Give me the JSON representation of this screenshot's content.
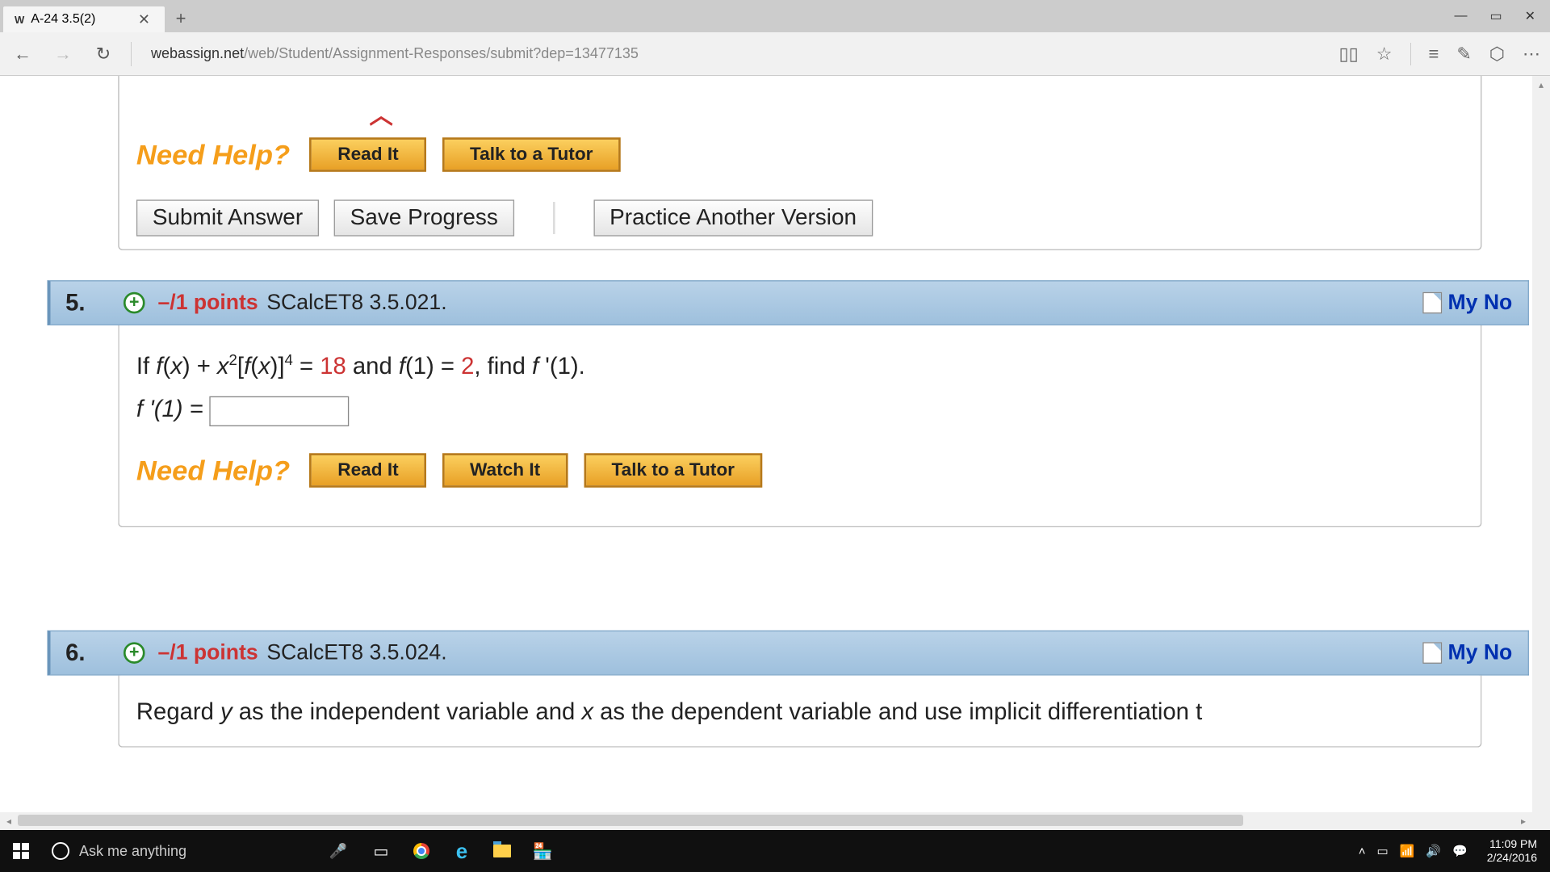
{
  "window": {
    "tab_title": "A-24 3.5(2)",
    "minimize": "—",
    "maximize": "▭",
    "close": "✕",
    "new_tab": "+",
    "tab_close": "✕"
  },
  "toolbar": {
    "back": "←",
    "forward": "→",
    "refresh": "↻",
    "url_domain": "webassign.net",
    "url_path": "/web/Student/Assignment-Responses/submit?dep=13477135",
    "reading": "▯▯",
    "star": "☆",
    "hub": "≡",
    "note": "✎",
    "share": "⬡",
    "more": "⋯"
  },
  "q4": {
    "need_help": "Need Help?",
    "read_it": "Read It",
    "talk_tutor": "Talk to a Tutor",
    "submit": "Submit Answer",
    "save": "Save Progress",
    "practice": "Practice Another Version",
    "chevron": "︿"
  },
  "q5": {
    "number": "5.",
    "expand": "+",
    "points": "–/1 points",
    "reference": "SCalcET8 3.5.021.",
    "my_notes": "My No",
    "problem_prefix": "If  ",
    "eq_lhs1": "f",
    "eq_lhs2": "(",
    "eq_lhs3": "x",
    "eq_lhs4": ") + ",
    "eq_lhs5": "x",
    "sup2": "2",
    "eq_lhs6": "[",
    "eq_lhs7": "f",
    "eq_lhs8": "(",
    "eq_lhs9": "x",
    "eq_lhs10": ")]",
    "sup4": "4",
    "eq_mid": " = ",
    "eighteen": "18",
    "eq_and": " and ",
    "eq_f1": "f",
    "eq_f1p": "(1) = ",
    "two": "2",
    "eq_find": ",  find ",
    "eq_target": "f ",
    "prime": "'",
    "eq_target2": "(1).",
    "answer_label": "f '(1) = ",
    "need_help": "Need Help?",
    "read_it": "Read It",
    "watch_it": "Watch It",
    "talk_tutor": "Talk to a Tutor"
  },
  "q6": {
    "number": "6.",
    "expand": "+",
    "points": "–/1 points",
    "reference": "SCalcET8 3.5.024.",
    "my_notes": "My No",
    "text_prefix": "Regard ",
    "y": "y",
    "text_mid1": " as the independent variable and ",
    "x": "x",
    "text_mid2": " as the dependent variable and use implicit differentiation t"
  },
  "taskbar": {
    "cortana": "Ask me anything",
    "time": "11:09 PM",
    "date": "2/24/2016"
  }
}
